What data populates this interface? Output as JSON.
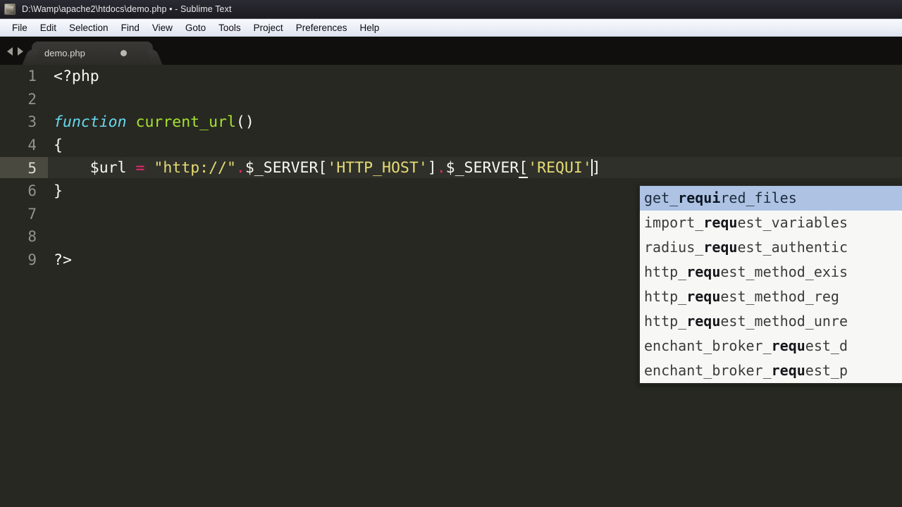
{
  "window": {
    "title": "D:\\Wamp\\apache2\\htdocs\\demo.php • - Sublime Text",
    "app_icon": "sublime-text-icon"
  },
  "menubar": {
    "items": [
      {
        "label": "File"
      },
      {
        "label": "Edit"
      },
      {
        "label": "Selection"
      },
      {
        "label": "Find"
      },
      {
        "label": "View"
      },
      {
        "label": "Goto"
      },
      {
        "label": "Tools"
      },
      {
        "label": "Project"
      },
      {
        "label": "Preferences"
      },
      {
        "label": "Help"
      }
    ]
  },
  "tabstrip": {
    "nav_back_icon": "arrow-left-icon",
    "nav_forward_icon": "arrow-right-icon",
    "tabs": [
      {
        "label": "demo.php",
        "dirty": true,
        "active": true
      }
    ]
  },
  "editor": {
    "language": "PHP",
    "theme": "Monokai",
    "active_line": 5,
    "cursor_after_text": "REQUI",
    "lines": [
      {
        "number": "1",
        "text": "<?php"
      },
      {
        "number": "2",
        "text": ""
      },
      {
        "number": "3",
        "text": "function current_url()"
      },
      {
        "number": "4",
        "text": "{"
      },
      {
        "number": "5",
        "text": "    $url = \"http://\".$_SERVER['HTTP_HOST'].$_SERVER['REQUI']"
      },
      {
        "number": "6",
        "text": "}"
      },
      {
        "number": "7",
        "text": ""
      },
      {
        "number": "8",
        "text": ""
      },
      {
        "number": "9",
        "text": "?>"
      }
    ],
    "tokens": {
      "line1_open_tag": "<?php",
      "line3_keyword": "function",
      "line3_name": "current_url",
      "line3_parens": "()",
      "line4_brace": "{",
      "line5_var": "$url",
      "line5_assign": "=",
      "line5_string": "\"http://\"",
      "line5_concat1": ".",
      "line5_server1": "$_SERVER[",
      "line5_key1": "'HTTP_HOST'",
      "line5_close1": "]",
      "line5_concat2": ".",
      "line5_server2": "$_SERVER",
      "line5_bracket_open": "[",
      "line5_key2": "'REQUI'",
      "line5_close2": "]",
      "line6_brace": "}",
      "line9_close_tag": "?>"
    }
  },
  "autocomplete": {
    "query": "REQUI",
    "selected_index": 0,
    "items": [
      {
        "prefix": "get_",
        "match": "requi",
        "suffix": "red_files"
      },
      {
        "prefix": "import_",
        "match": "requ",
        "suffix": "est_variables"
      },
      {
        "prefix": "radius_",
        "match": "requ",
        "suffix": "est_authentic"
      },
      {
        "prefix": "http_",
        "match": "requ",
        "suffix": "est_method_exis"
      },
      {
        "prefix": "http_",
        "match": "requ",
        "suffix": "est_method_reg"
      },
      {
        "prefix": "http_",
        "match": "requ",
        "suffix": "est_method_unre"
      },
      {
        "prefix": "enchant_broker_",
        "match": "requ",
        "suffix": "est_d"
      },
      {
        "prefix": "enchant_broker_",
        "match": "requ",
        "suffix": "est_p"
      }
    ]
  },
  "colors": {
    "editor_bg": "#272822",
    "active_line_bg": "#2f302a",
    "gutter_highlight": "#49493f",
    "keyword": "#66d9ef",
    "function_name": "#a6e22e",
    "operator": "#f92672",
    "string": "#e6db74",
    "plain_text": "#f8f8f2",
    "line_number": "#93938a",
    "popup_bg": "#f7f7f5",
    "popup_selected": "#aec3e3",
    "tab_bg": "#32312d",
    "tabstrip_bg": "#100f0d"
  }
}
